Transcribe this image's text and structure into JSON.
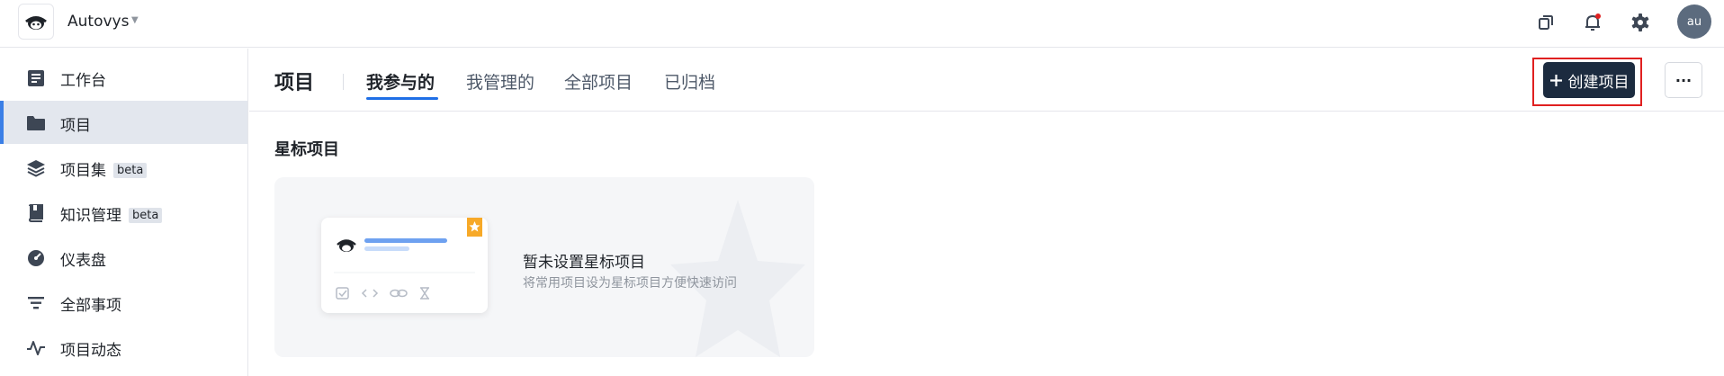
{
  "header": {
    "org_name": "Autovys",
    "avatar_initials": "au",
    "notification_dot_color": "#e02020"
  },
  "sidebar": {
    "items": [
      {
        "label": "工作台",
        "icon": "workbench-icon"
      },
      {
        "label": "项目",
        "icon": "folder-icon",
        "active": true
      },
      {
        "label": "项目集",
        "icon": "layers-icon",
        "badge": "beta"
      },
      {
        "label": "知识管理",
        "icon": "book-icon",
        "badge": "beta"
      },
      {
        "label": "仪表盘",
        "icon": "dashboard-icon"
      },
      {
        "label": "全部事项",
        "icon": "filter-icon"
      },
      {
        "label": "项目动态",
        "icon": "activity-icon"
      }
    ]
  },
  "main": {
    "title": "项目",
    "tabs": [
      {
        "label": "我参与的",
        "active": true
      },
      {
        "label": "我管理的"
      },
      {
        "label": "全部项目"
      },
      {
        "label": "已归档"
      }
    ],
    "create_label": "创建项目",
    "more_label": "···",
    "starred": {
      "section_title": "星标项目",
      "empty_title": "暂未设置星标项目",
      "empty_subtitle": "将常用项目设为星标项目方便快速访问"
    }
  },
  "colors": {
    "accent": "#1f6fe6",
    "primary_button": "#1c2b3f",
    "highlight_border": "#e02020",
    "star_badge": "#f7a928"
  }
}
